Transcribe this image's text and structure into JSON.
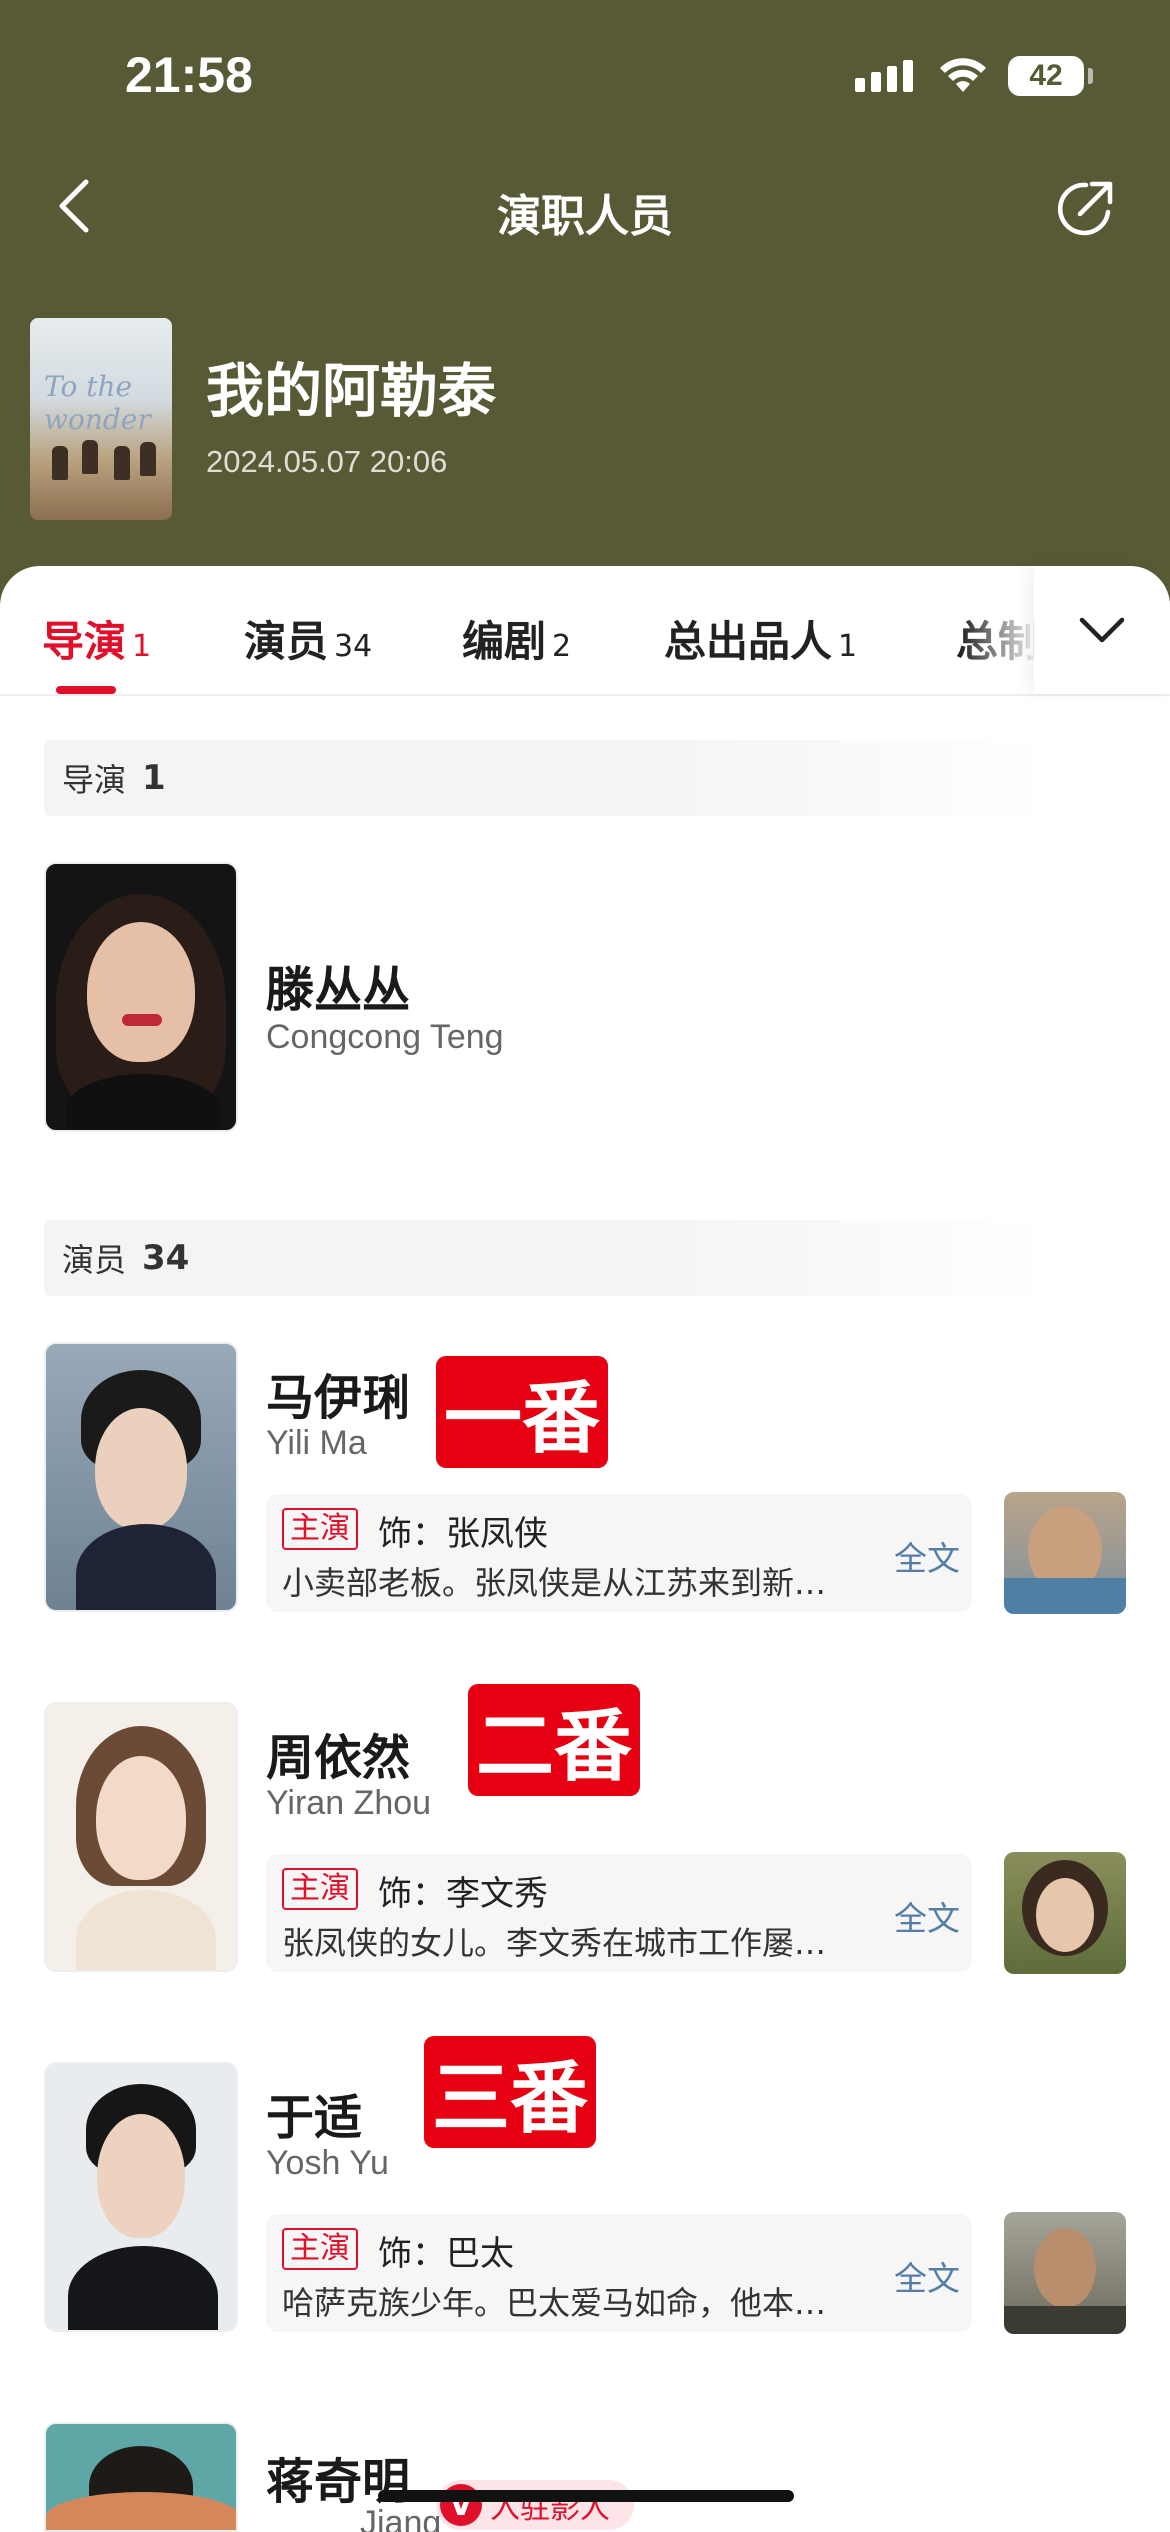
{
  "status_bar": {
    "time": "21:58",
    "battery": "42"
  },
  "nav": {
    "title": "演职人员"
  },
  "movie": {
    "title": "我的阿勒泰",
    "date": "2024.05.07 20:06",
    "poster_text": "To the wonder"
  },
  "tabs": [
    {
      "label": "导演",
      "count": "1"
    },
    {
      "label": "演员",
      "count": "34"
    },
    {
      "label": "编剧",
      "count": "2"
    },
    {
      "label": "总出品人",
      "count": "1"
    },
    {
      "label": "总制",
      "count": ""
    }
  ],
  "sections": {
    "directors": {
      "label": "导演",
      "count": "1"
    },
    "actors": {
      "label": "演员",
      "count": "34"
    }
  },
  "director": {
    "name_cn": "滕丛丛",
    "name_en": "Congcong Teng"
  },
  "actors": [
    {
      "name_cn": "马伊琍",
      "name_en": "Yili Ma",
      "rank": "一番",
      "role_tag": "主演",
      "character": "饰：张凤侠",
      "desc": "小卖部老板。张凤侠是从江苏来到新疆的汉族女人，独自带着孩子……",
      "more": "全文"
    },
    {
      "name_cn": "周依然",
      "name_en": "Yiran Zhou",
      "rank": "二番",
      "role_tag": "主演",
      "character": "饰：李文秀",
      "desc": "张凤侠的女儿。李文秀在城市工作屡屡碰壁，回到家乡……",
      "more": "全文"
    },
    {
      "name_cn": "于适",
      "name_en": "Yosh Yu",
      "rank": "三番",
      "role_tag": "主演",
      "character": "饰：巴太",
      "desc": "哈萨克族少年。巴太爱马如命，他本想成为一名驯马师……",
      "more": "全文"
    },
    {
      "name_cn": "蒋奇明",
      "name_en": "Jiang",
      "verified": "入驻影人"
    }
  ],
  "colors": {
    "header_bg": "#585935",
    "accent": "#e0102b",
    "badge": "#e60012",
    "link": "#557ea6"
  }
}
